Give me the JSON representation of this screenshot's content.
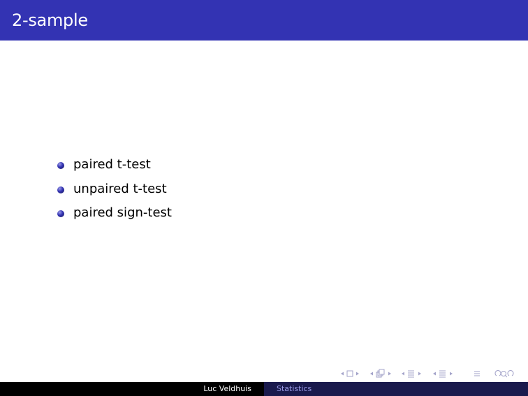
{
  "slide": {
    "title": "2-sample",
    "bullets": [
      "paired t-test",
      "unpaired t-test",
      "paired sign-test"
    ]
  },
  "footer": {
    "author": "Luc Veldhuis",
    "title": "Statistics"
  },
  "navigation": {
    "icons": [
      "nav-frame-icon",
      "nav-subsection-icon",
      "nav-section-icon",
      "nav-document-icon",
      "nav-appendix-icon",
      "nav-search-icon"
    ]
  },
  "colors": {
    "title_bar": "#3333b3",
    "footer_left": "#000000",
    "footer_right": "#1a1a4d",
    "bullet": "#3333b3"
  }
}
